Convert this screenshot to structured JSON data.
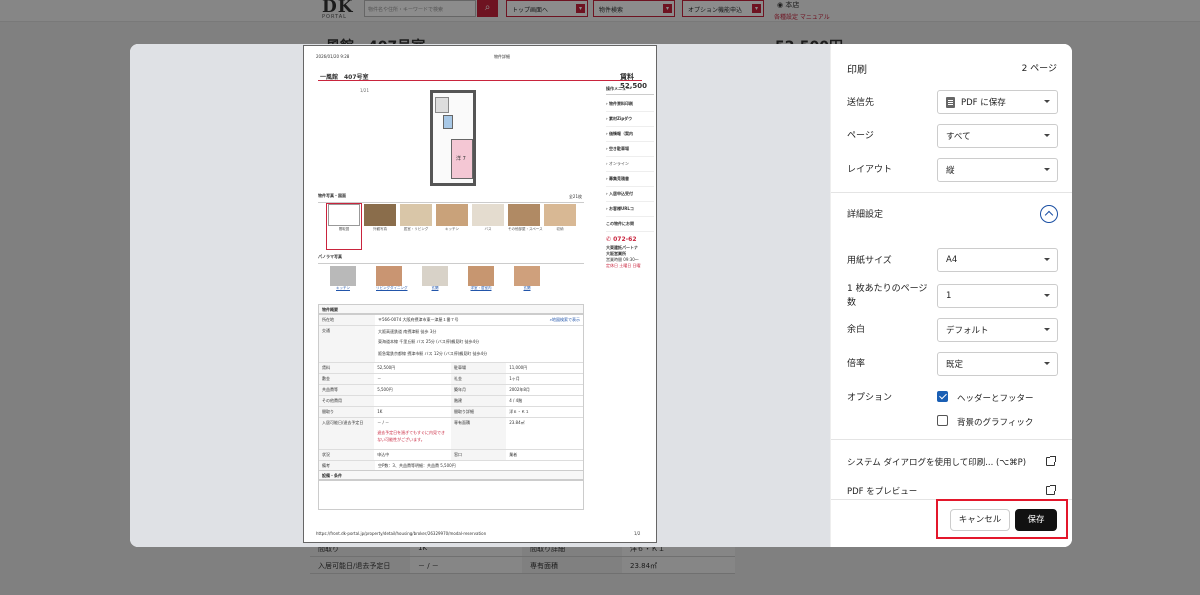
{
  "background": {
    "logo_main": "DK",
    "logo_sub": "PORTAL",
    "search_placeholder": "物件名や住所・キーワードで検索",
    "nav": [
      {
        "label": "トップ画面へ"
      },
      {
        "label": "物件検索"
      },
      {
        "label": "オプション機能申込"
      }
    ],
    "user": "本店",
    "links": "各種設定  マニュアル",
    "page_title": "一風館　407号室",
    "price": "52,500円",
    "rows": [
      {
        "l1": "間取り",
        "v1": "1K",
        "l2": "間取り詳細",
        "v2": "洋６・Ｋ１"
      },
      {
        "l1": "入居可能日/退去予定日",
        "v1": "－ / －",
        "l2": "専有面積",
        "v2": "23.84㎡"
      }
    ]
  },
  "preview": {
    "date": "2026/01/20 9:28",
    "doc_title": "物件詳細",
    "property_name": "一風館　407号室",
    "price": "賃料 52,500",
    "image_count": "1/21",
    "floor_label": "洋 7",
    "menu_head": "操作メニュー",
    "menu_items": [
      "物件資料印刷",
      "素材Zipダウ",
      "価情報（案内",
      "空き駐車場",
      "オンライン",
      "募集見積書",
      "入居申込受付",
      "お客様URLコ"
    ],
    "contact_head": "この物件にお問",
    "phone": "072-62",
    "contact_lines": [
      "大東建託パートナ",
      "大阪営業所",
      "営業時間 09:30～",
      "定休日 土曜日 日曜"
    ],
    "photos_title": "物件写真・図面",
    "photos_count": "全21枚",
    "photos": [
      {
        "cap": "間取図",
        "color": "#ffffff"
      },
      {
        "cap": "外観写真",
        "color": "#8a6d4b"
      },
      {
        "cap": "居室・リビング",
        "color": "#d9c6a8"
      },
      {
        "cap": "キッチン",
        "color": "#c9a27a"
      },
      {
        "cap": "バス",
        "color": "#e4dccf"
      },
      {
        "cap": "その他部屋・スペース",
        "color": "#b08a64"
      },
      {
        "cap": "収納",
        "color": "#d8b894"
      }
    ],
    "pano_title": "パノラマ写真",
    "panos": [
      {
        "cap": "キッチン",
        "color": "#b9b9b9"
      },
      {
        "cap": "リビングダイニング",
        "color": "#c99572"
      },
      {
        "cap": "玄関",
        "color": "#d8d2c8"
      },
      {
        "cap": "洋室・居室内",
        "color": "#c79670"
      },
      {
        "cap": "玄関",
        "color": "#cfa07c"
      }
    ],
    "overview_title": "物件概要",
    "address_label": "所在地",
    "address": "〒566-0074 大阪府摂津市東一津屋１番７号",
    "map_link": "地図検索で表示",
    "transit_label": "交通",
    "transit": [
      "大阪高速鉄道 南摂津駅 徒歩 3分",
      "東海道本線 千里丘駅 バス 25分 (バス停)鶴見町 徒歩4分",
      "阪急電鉄京都線 摂津市駅 バス 12分 (バス停)鶴見町 徒歩4分"
    ],
    "rows": [
      {
        "l1": "賃料",
        "v1": "52,500円",
        "l2": "駐車場",
        "v2": "11,000円"
      },
      {
        "l1": "敷金",
        "v1": "－",
        "l2": "礼金",
        "v2": "1ヶ月"
      },
      {
        "l1": "共益費等",
        "v1": "5,500円",
        "l2": "築年月",
        "v2": "2002年8月"
      },
      {
        "l1": "その他費用",
        "v1": "",
        "l2": "階建",
        "v2": "4 / 4階"
      },
      {
        "l1": "間取り",
        "v1": "1K",
        "l2": "間取り詳細",
        "v2": "洋６・Ｋ１"
      }
    ],
    "move_label": "入居可能日/退去予定日",
    "move_value": "－ / －",
    "move_note": "退去予定日を過ぎてもすぐに内見できない可能性がございます。",
    "area_label": "専有面積",
    "area_value": "23.84㎡",
    "status_label": "状況",
    "status_value": "申込中",
    "window_label": "窓口",
    "window_value": "業者",
    "notes_label": "備考",
    "notes_value": "空P数：3、共益費等明細：共益費 5,500円",
    "equip_title": "設備・条件",
    "footer_url": "https://front.dk-portal.jp/property/detail/housing/broker/26329970/modal-reservation",
    "footer_page": "1/2"
  },
  "settings": {
    "title": "印刷",
    "pages": "2 ページ",
    "destination_label": "送信先",
    "destination_value": "PDF に保存",
    "page_label": "ページ",
    "page_value": "すべて",
    "layout_label": "レイアウト",
    "layout_value": "縦",
    "advanced_label": "詳細設定",
    "paper_label": "用紙サイズ",
    "paper_value": "A4",
    "pps_label": "1 枚あたりのページ数",
    "pps_value": "1",
    "margin_label": "余白",
    "margin_value": "デフォルト",
    "scale_label": "倍率",
    "scale_value": "既定",
    "options_label": "オプション",
    "opt_header_footer": "ヘッダーとフッター",
    "opt_header_footer_checked": true,
    "opt_background": "背景のグラフィック",
    "opt_background_checked": false,
    "system_dialog": "システム ダイアログを使用して印刷... (⌥⌘P)",
    "pdf_preview": "PDF をプレビュー",
    "cancel": "キャンセル",
    "save": "保存"
  }
}
